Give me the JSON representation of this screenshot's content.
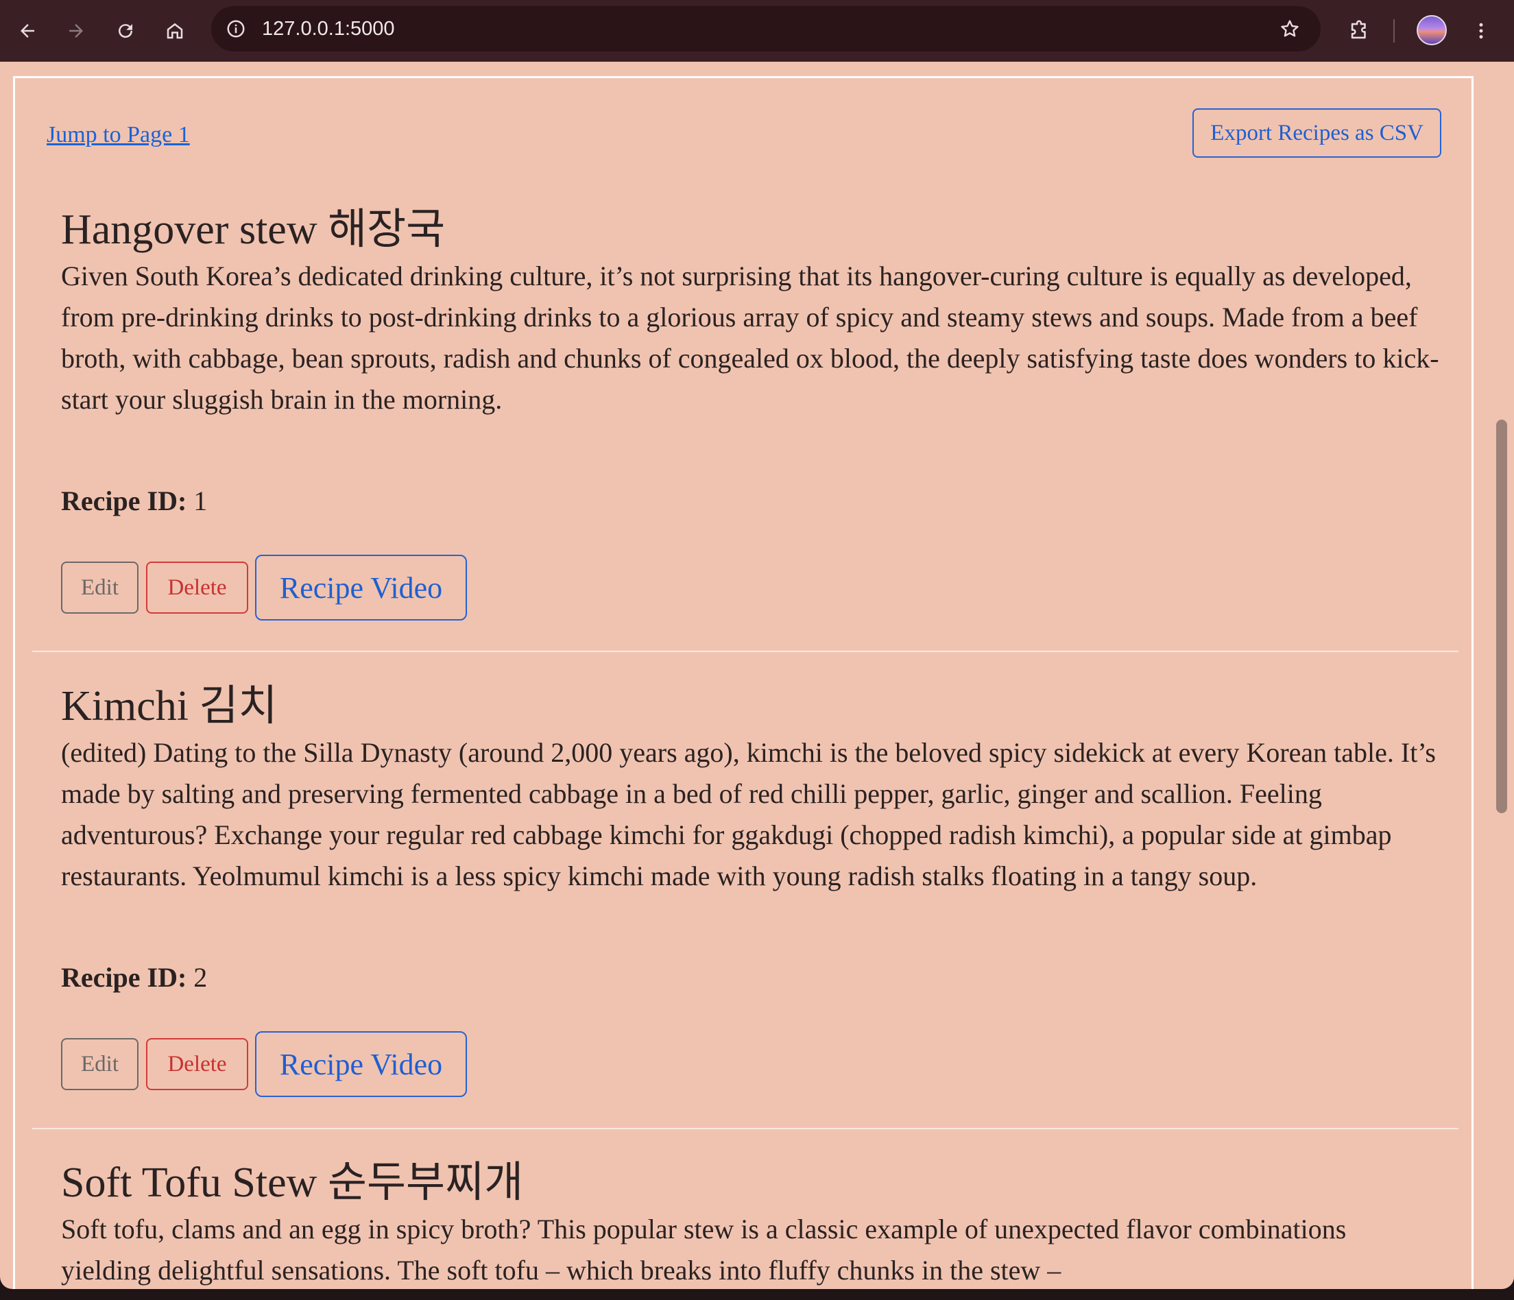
{
  "browser": {
    "url": "127.0.0.1:5000",
    "back_icon": "back-arrow-icon",
    "forward_icon": "forward-arrow-icon",
    "reload_icon": "reload-icon",
    "home_icon": "home-icon",
    "info_icon": "site-info-icon",
    "bookmark_icon": "star-icon",
    "extensions_icon": "puzzle-icon",
    "menu_icon": "kebab-menu-icon"
  },
  "page": {
    "jump_link": "Jump to Page 1",
    "export_button": "Export Recipes as CSV",
    "background": "#f0c3b0",
    "accent": "#1f5fd1",
    "danger": "#c73131"
  },
  "recipes": [
    {
      "title": "Hangover stew 해장국",
      "description": "Given South Korea’s dedicated drinking culture, it’s not surprising that its hangover-curing culture is equally as developed, from pre-drinking drinks to post-drinking drinks to a glorious array of spicy and steamy stews and soups. Made from a beef broth, with cabbage, bean sprouts, radish and chunks of congealed ox blood, the deeply satisfying taste does wonders to kick-start your sluggish brain in the morning.",
      "id_label": "Recipe ID:",
      "id_value": "1",
      "edit_label": "Edit",
      "delete_label": "Delete",
      "video_label": "Recipe Video"
    },
    {
      "title": "Kimchi 김치",
      "description": "(edited) Dating to the Silla Dynasty (around 2,000 years ago), kimchi is the beloved spicy sidekick at every Korean table. It’s made by salting and preserving fermented cabbage in a bed of red chilli pepper, garlic, ginger and scallion. Feeling adventurous? Exchange your regular red cabbage kimchi for ggakdugi (chopped radish kimchi), a popular side at gimbap restaurants. Yeolmumul kimchi is a less spicy kimchi made with young radish stalks floating in a tangy soup.",
      "id_label": "Recipe ID:",
      "id_value": "2",
      "edit_label": "Edit",
      "delete_label": "Delete",
      "video_label": "Recipe Video"
    },
    {
      "title": "Soft Tofu Stew 순두부찌개",
      "description": "Soft tofu, clams and an egg in spicy broth? This popular stew is a classic example of unexpected flavor combinations yielding delightful sensations. The soft tofu – which breaks into fluffy chunks in the stew –"
    }
  ]
}
